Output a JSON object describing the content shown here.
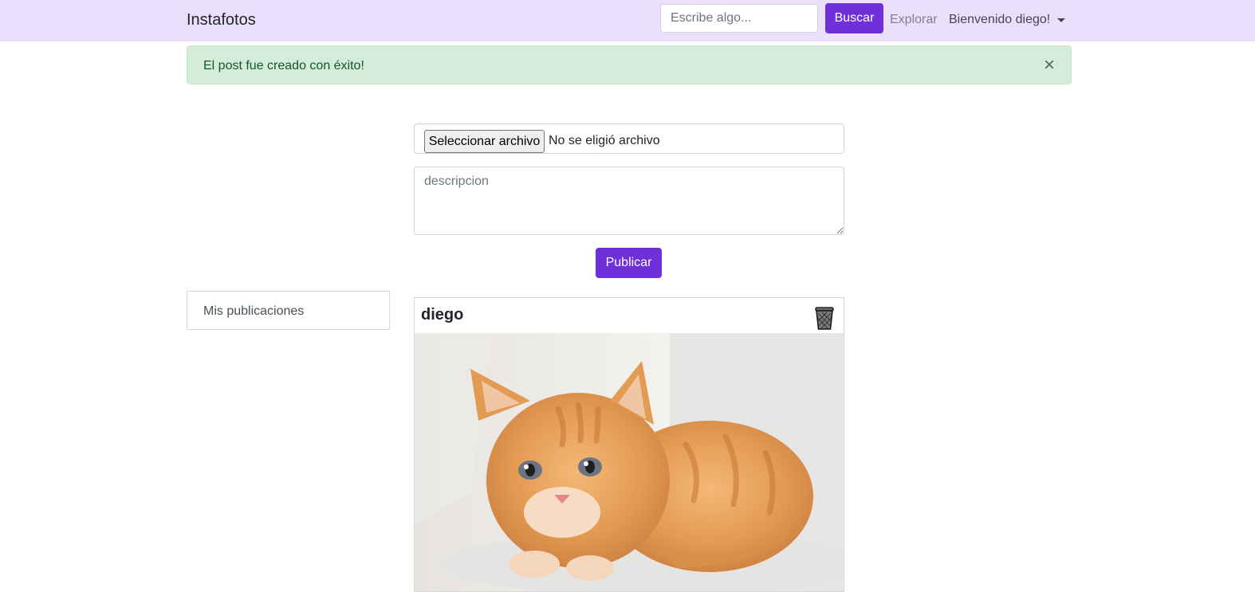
{
  "navbar": {
    "brand": "Instafotos",
    "search_placeholder": "Escribe algo...",
    "search_button": "Buscar",
    "explore_link": "Explorar",
    "user_menu": "Bienvenido diego!"
  },
  "alert": {
    "message": "El post fue creado con éxito!",
    "close_symbol": "×"
  },
  "form": {
    "file_button": "Seleccionar archivo",
    "file_status": "No se eligió archivo",
    "description_placeholder": "descripcion",
    "publish_button": "Publicar"
  },
  "sidebar": {
    "my_posts": "Mis publicaciones"
  },
  "post": {
    "username": "diego",
    "delete_icon": "trash-icon",
    "photo_subject": "orange-kitten-photo"
  },
  "colors": {
    "navbar_bg": "#ebe0fc",
    "primary": "#6f2fd9",
    "alert_bg": "#d4edda",
    "alert_text": "#155724"
  }
}
